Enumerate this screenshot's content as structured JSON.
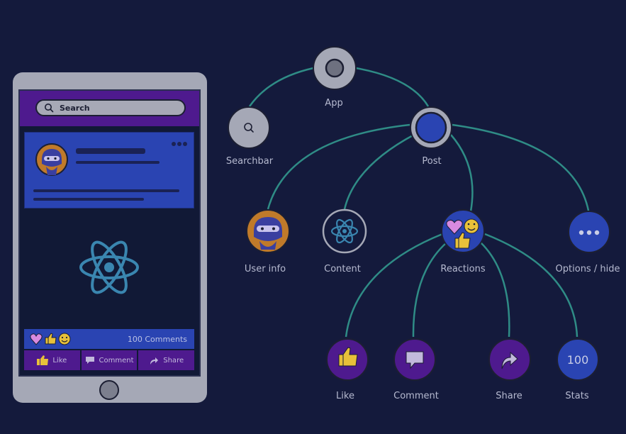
{
  "phone": {
    "search_placeholder": "Search",
    "comments_count": "100 Comments",
    "actions": [
      {
        "label": "Like",
        "icon": "thumbs-up-icon"
      },
      {
        "label": "Comment",
        "icon": "comment-icon"
      },
      {
        "label": "Share",
        "icon": "share-icon"
      }
    ]
  },
  "tree": {
    "nodes": [
      {
        "id": "app",
        "label": "App"
      },
      {
        "id": "searchbar",
        "label": "Searchbar"
      },
      {
        "id": "post",
        "label": "Post"
      },
      {
        "id": "userinfo",
        "label": "User info"
      },
      {
        "id": "content",
        "label": "Content"
      },
      {
        "id": "reactions",
        "label": "Reactions"
      },
      {
        "id": "options",
        "label": "Options / hide"
      },
      {
        "id": "like",
        "label": "Like"
      },
      {
        "id": "comment",
        "label": "Comment"
      },
      {
        "id": "share",
        "label": "Share"
      },
      {
        "id": "stats",
        "label": "Stats",
        "value": "100"
      }
    ],
    "edges": [
      [
        "app",
        "searchbar"
      ],
      [
        "app",
        "post"
      ],
      [
        "post",
        "userinfo"
      ],
      [
        "post",
        "content"
      ],
      [
        "post",
        "reactions"
      ],
      [
        "post",
        "options"
      ],
      [
        "reactions",
        "like"
      ],
      [
        "reactions",
        "comment"
      ],
      [
        "reactions",
        "share"
      ],
      [
        "reactions",
        "stats"
      ]
    ]
  },
  "colors": {
    "background": "#141a3c",
    "edge": "#2f8c86",
    "purple": "#4e1a8e",
    "blue": "#2a44b2",
    "gray": "#a5a8b6"
  }
}
